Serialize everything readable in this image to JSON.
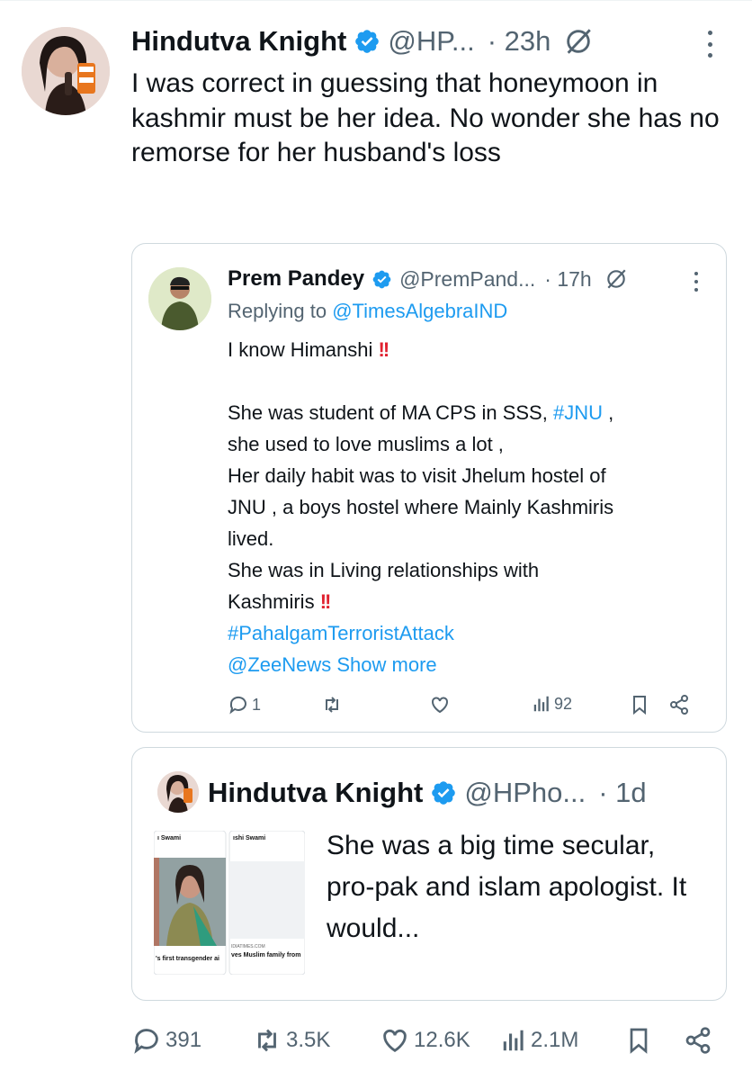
{
  "main_tweet": {
    "author_name": "Hindutva Knight",
    "author_handle": "@HP...",
    "time": "· 23h",
    "text": "I was correct in guessing that honeymoon in kashmir must be her idea. No wonder she has no remorse for her husband's loss",
    "actions": {
      "replies": "391",
      "reposts": "3.5K",
      "likes": "12.6K",
      "views": "2.1M"
    }
  },
  "quote_1": {
    "author_name": "Prem Pandey",
    "author_handle": "@PremPand...",
    "time": "· 17h",
    "replying_prefix": "Replying to ",
    "replying_to": "@TimesAlgebraIND",
    "line_1": "I know Himanshi ",
    "line_2a": "She was student of MA CPS in SSS, ",
    "line_2_hashtag": "#JNU",
    "line_2b": " ,",
    "line_3": "she used to love muslims a lot ,",
    "line_4": "Her daily habit was to visit Jhelum hostel of",
    "line_5": "JNU , a boys hostel where Mainly Kashmiris",
    "line_6": "lived.",
    "line_7": "She was in Living relationships with",
    "line_8": "Kashmiris ",
    "hashtag_2": "#PahalgamTerroristAttack",
    "mention_2": "@ZeeNews",
    "show_more": " Show more",
    "bang": "!!",
    "actions": {
      "replies": "1",
      "views": "92"
    }
  },
  "quote_2": {
    "author_name": "Hindutva Knight",
    "author_handle": "@HPho...",
    "time": "· 1d",
    "text": "She was a big time secular, pro-pak and islam apologist. It would...",
    "thumbnail": {
      "left_name": "ı Swami",
      "right_name": "ıshi Swami",
      "left_caption": "'s first transgender ai",
      "right_source": "IDIATIMES.COM",
      "right_caption": "ves Muslim family from"
    }
  },
  "colors": {
    "link": "#1d9bf0",
    "secondary_text": "#536471",
    "border": "#cfd9de",
    "verified": "#1d9bf0",
    "bang": "#e0212f"
  },
  "icons": [
    "verified-badge-icon",
    "grok-icon",
    "more-icon",
    "reply-icon",
    "repost-icon",
    "like-icon",
    "views-icon",
    "bookmark-icon",
    "share-icon"
  ]
}
